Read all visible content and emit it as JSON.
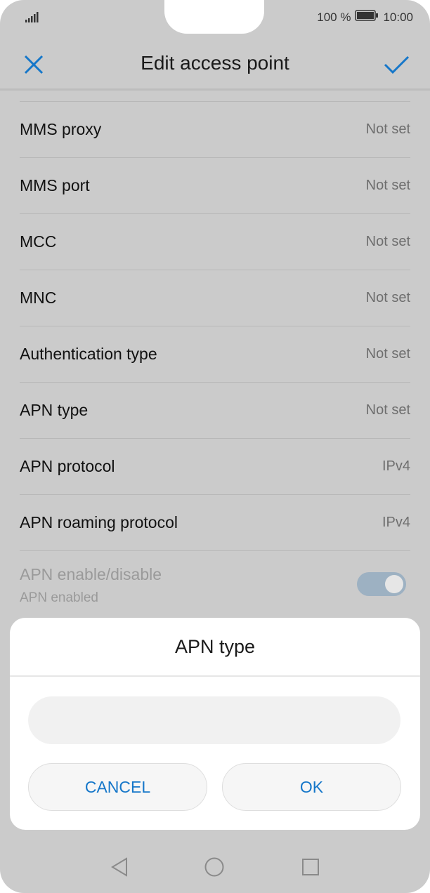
{
  "status_bar": {
    "battery_percent": "100 %",
    "time": "10:00",
    "signal_icon": "signal-icon",
    "battery_icon": "battery-icon"
  },
  "header": {
    "title": "Edit access point",
    "close_icon": "close-icon",
    "confirm_icon": "check-icon",
    "accent": "#1677c9"
  },
  "settings": [
    {
      "label": "MMS proxy",
      "value": "Not set"
    },
    {
      "label": "MMS port",
      "value": "Not set"
    },
    {
      "label": "MCC",
      "value": "Not set"
    },
    {
      "label": "MNC",
      "value": "Not set"
    },
    {
      "label": "Authentication type",
      "value": "Not set"
    },
    {
      "label": "APN type",
      "value": "Not set"
    },
    {
      "label": "APN protocol",
      "value": "IPv4"
    },
    {
      "label": "APN roaming protocol",
      "value": "IPv4"
    }
  ],
  "apn_toggle": {
    "label": "APN enable/disable",
    "sublabel": "APN enabled",
    "state": "on",
    "disabled": true
  },
  "dialog": {
    "title": "APN type",
    "input_value": "",
    "cancel_label": "CANCEL",
    "ok_label": "OK"
  },
  "nav_bar": {
    "back_icon": "back-triangle-icon",
    "home_icon": "home-circle-icon",
    "recents_icon": "recents-square-icon"
  }
}
